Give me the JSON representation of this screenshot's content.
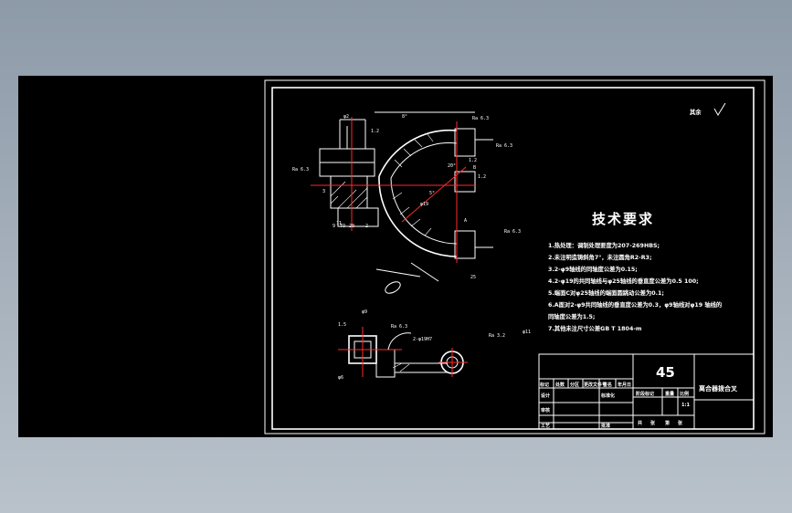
{
  "colors": {
    "background": "#000000",
    "line": "#ffffff",
    "center_line": "#ff2a2a",
    "window_frame": "#9aa6b2"
  },
  "requirements": {
    "title": "技术要求",
    "lines": [
      "1.热处理：调制处理要度为207-269HBS;",
      "2.未注明造铸斜角7°，未注圆角R2-R3;",
      "3.2-φ9轴线的同轴度公差为0.15;",
      "4.2-φ19的共同轴线与φ25轴线的垂直度公差为0.5  100;",
      "5.端面C对φ25轴线的端面圆跳动公差为0.1;",
      "6.A面对2-φ9共同轴线的垂直度公差为0.3，φ9轴线对φ19 轴线的",
      "同轴度公差为1.5;",
      "7.其他未注尺寸公差GB  T 1804-m"
    ]
  },
  "corner_note": {
    "label": "其余"
  },
  "title_block": {
    "material": "45",
    "part_name": "离合器拨合叉",
    "row1": [
      "标记",
      "处数",
      "分区",
      "更改文件号",
      "签名",
      "年月日"
    ],
    "row2": [
      "设计",
      "",
      "标准化"
    ],
    "row3": [
      "审核",
      "",
      ""
    ],
    "row4": [
      "工艺",
      "",
      "批准"
    ],
    "mid_headers": [
      "阶段标记",
      "重量",
      "比例"
    ],
    "scale": "1:1",
    "sheet": [
      "共",
      "张",
      "第",
      "张"
    ]
  },
  "dimensions": {
    "top_view": [
      "φ2",
      "1.2",
      "8°",
      "Ra 6.3",
      "Ra 6.3",
      "Ra 6.3",
      "Ra 6.3",
      "20°",
      "1.2",
      "1.2",
      "φ19",
      "25",
      "3",
      "11",
      "9",
      "TO",
      "20",
      "2",
      "B",
      "A",
      "5°"
    ],
    "side_view": [
      "φ9",
      "Ra 6.3",
      "2-φ19H7",
      "Ra 3.2",
      "φ11",
      "1.5",
      "φ6"
    ]
  }
}
